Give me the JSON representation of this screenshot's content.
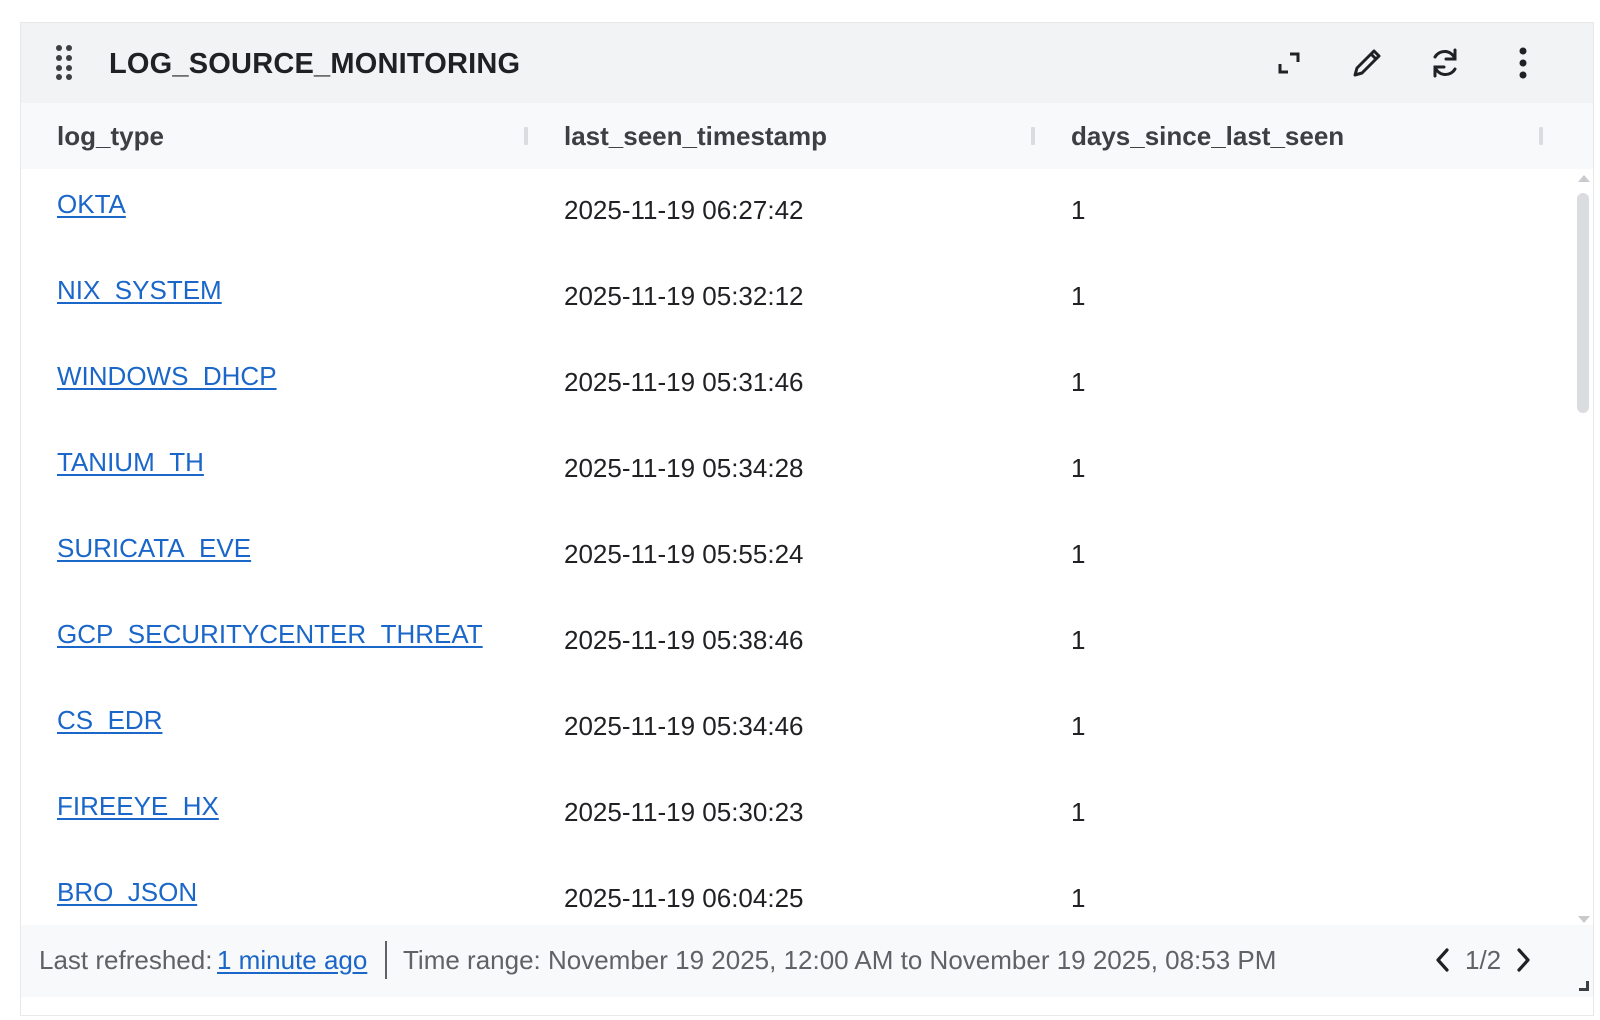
{
  "panel": {
    "title": "LOG_SOURCE_MONITORING",
    "icons": {
      "drag": "drag-handle-icon",
      "expand": "expand-icon",
      "edit": "pencil-icon",
      "refresh": "refresh-icon",
      "menu": "more-vert-icon"
    }
  },
  "table": {
    "columns": [
      "log_type",
      "last_seen_timestamp",
      "days_since_last_seen"
    ],
    "rows": [
      {
        "log_type": "OKTA",
        "last_seen_timestamp": "2025-11-19 06:27:42",
        "days_since_last_seen": "1"
      },
      {
        "log_type": "NIX_SYSTEM",
        "last_seen_timestamp": "2025-11-19 05:32:12",
        "days_since_last_seen": "1"
      },
      {
        "log_type": "WINDOWS_DHCP",
        "last_seen_timestamp": "2025-11-19 05:31:46",
        "days_since_last_seen": "1"
      },
      {
        "log_type": "TANIUM_TH",
        "last_seen_timestamp": "2025-11-19 05:34:28",
        "days_since_last_seen": "1"
      },
      {
        "log_type": "SURICATA_EVE",
        "last_seen_timestamp": "2025-11-19 05:55:24",
        "days_since_last_seen": "1"
      },
      {
        "log_type": "GCP_SECURITYCENTER_THREAT",
        "last_seen_timestamp": "2025-11-19 05:38:46",
        "days_since_last_seen": "1"
      },
      {
        "log_type": "CS_EDR",
        "last_seen_timestamp": "2025-11-19 05:34:46",
        "days_since_last_seen": "1"
      },
      {
        "log_type": "FIREEYE_HX",
        "last_seen_timestamp": "2025-11-19 05:30:23",
        "days_since_last_seen": "1"
      },
      {
        "log_type": "BRO_JSON",
        "last_seen_timestamp": "2025-11-19 06:04:25",
        "days_since_last_seen": "1"
      }
    ]
  },
  "footer": {
    "last_refreshed_label": "Last refreshed:",
    "last_refreshed_value": "1 minute ago",
    "time_range": "Time range: November 19 2025, 12:00 AM to November 19 2025, 08:53 PM",
    "page": "1/2",
    "icons": {
      "prev": "chevron-left-icon",
      "next": "chevron-right-icon"
    }
  },
  "colors": {
    "header_bg": "#f1f3f4",
    "link": "#1a66c9",
    "text": "#202124",
    "muted": "#5f6368"
  }
}
